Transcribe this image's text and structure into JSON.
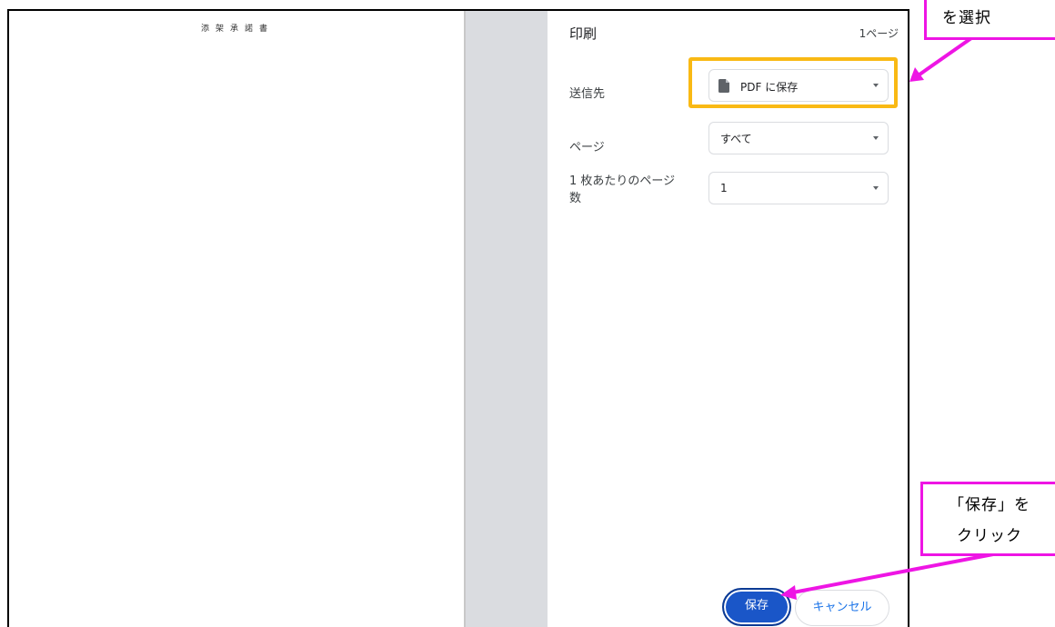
{
  "preview": {
    "doc_title": "添架承諾書"
  },
  "settings": {
    "title": "印刷",
    "page_count": "1ページ",
    "destination": {
      "label": "送信先",
      "value": "PDF に保存"
    },
    "pages": {
      "label": "ページ",
      "value": "すべて"
    },
    "pages_per_sheet": {
      "label": "1 枚あたりのページ数",
      "label_line1": "1 枚あたりのページ",
      "label_line2": "数",
      "value": "1"
    }
  },
  "buttons": {
    "save": "保存",
    "cancel": "キャンセル"
  },
  "annotations": {
    "top_callout": "を選択",
    "bottom_callout_line1": "「保存」を",
    "bottom_callout_line2": "クリック"
  },
  "colors": {
    "highlight": "#f9b914",
    "callout": "#ee15e4",
    "primary": "#1a56c8",
    "link": "#1a73e8"
  }
}
